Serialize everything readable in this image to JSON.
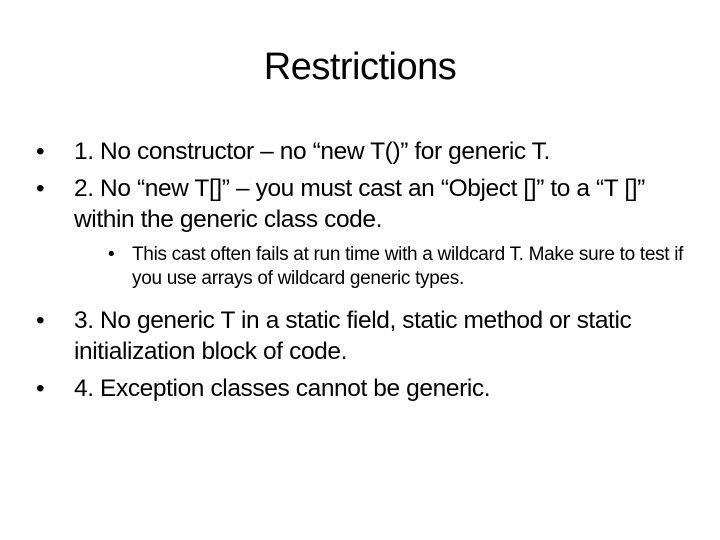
{
  "slide": {
    "title": "Restrictions",
    "bullet_glyph": "•",
    "items": [
      {
        "text": "1. No constructor – no “new T()” for generic T."
      },
      {
        "text": "2. No “new T[]” – you must cast an “Object []” to a “T []” within the generic class code."
      }
    ],
    "sub_item": {
      "text": "This cast often fails at run time with a wildcard T. Make sure to test if you use arrays of wildcard generic types."
    },
    "items_after": [
      {
        "text": "3. No generic T in a static field, static method or static initialization block of code."
      },
      {
        "text": "4. Exception classes cannot be generic."
      }
    ]
  }
}
